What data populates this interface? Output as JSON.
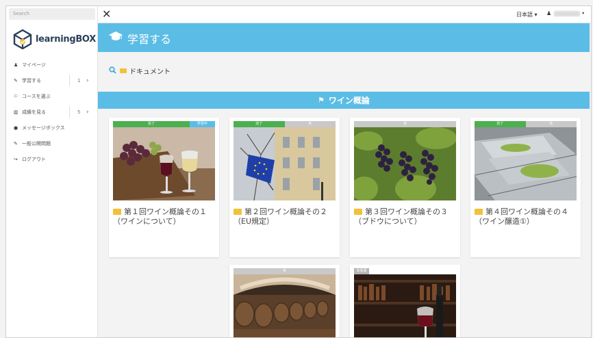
{
  "sidebar": {
    "search_placeholder": "Search",
    "logo_text": "learningBOX",
    "items": [
      {
        "icon": "user-icon",
        "glyph": "♟",
        "label": "マイページ",
        "count": "",
        "chevron": ""
      },
      {
        "icon": "pencil-icon",
        "glyph": "✎",
        "label": "学習する",
        "count": "1",
        "chevron": "›"
      },
      {
        "icon": "flag-icon",
        "glyph": "⚐",
        "label": "コースを選ぶ",
        "count": "",
        "chevron": ""
      },
      {
        "icon": "chart-icon",
        "glyph": "▥",
        "label": "成績を見る",
        "count": "5",
        "chevron": "›"
      },
      {
        "icon": "chat-icon",
        "glyph": "●",
        "label": "メッセージボックス",
        "count": "",
        "chevron": ""
      },
      {
        "icon": "pencil-icon",
        "glyph": "✎",
        "label": "一般公開問題",
        "count": "",
        "chevron": ""
      },
      {
        "icon": "logout-icon",
        "glyph": "↪",
        "label": "ログアウト",
        "count": "",
        "chevron": ""
      }
    ]
  },
  "topbar": {
    "close_glyph": "✕",
    "language": "日本語 ▾",
    "user_icon": "♟"
  },
  "header": {
    "icon": "graduation-cap-icon",
    "icon_glyph": "🎓",
    "title": "学習する"
  },
  "breadcrumb": {
    "search_glyph": "🔍",
    "folder": "ドキュメント"
  },
  "section": {
    "flag_glyph": "⚑",
    "title": "ワイン概論"
  },
  "cards": [
    {
      "title": "第１回ワイン概論その１（ワインについて）",
      "bars": [
        {
          "label": "完了",
          "color": "#4caf50",
          "flex": 3
        },
        {
          "label": "学習中",
          "color": "#5bbde6",
          "flex": 1
        }
      ]
    },
    {
      "title": "第２回ワイン概論その２（EU規定）",
      "bars": [
        {
          "label": "完了",
          "color": "#4caf50",
          "flex": 1
        },
        {
          "label": "未",
          "color": "#c9c9c9",
          "flex": 1
        }
      ]
    },
    {
      "title": "第３回ワイン概論その３（ブドウについて）",
      "bars": [
        {
          "label": "未",
          "color": "#c9c9c9",
          "flex": 1
        }
      ]
    },
    {
      "title": "第４回ワイン概論その４（ワイン醸造①）",
      "bars": [
        {
          "label": "完了",
          "color": "#4caf50",
          "flex": 1
        },
        {
          "label": "未",
          "color": "#c9c9c9",
          "flex": 1
        }
      ]
    },
    {
      "title": "",
      "bars": [
        {
          "label": "未",
          "color": "#c9c9c9",
          "flex": 1
        }
      ]
    },
    {
      "title": "",
      "bars": [
        {
          "label": "未受講",
          "color": "#b5b5b5",
          "flex": 1
        }
      ]
    }
  ],
  "colors": {
    "accent": "#5bbde6",
    "done": "#4caf50",
    "folder": "#f0c13b"
  }
}
